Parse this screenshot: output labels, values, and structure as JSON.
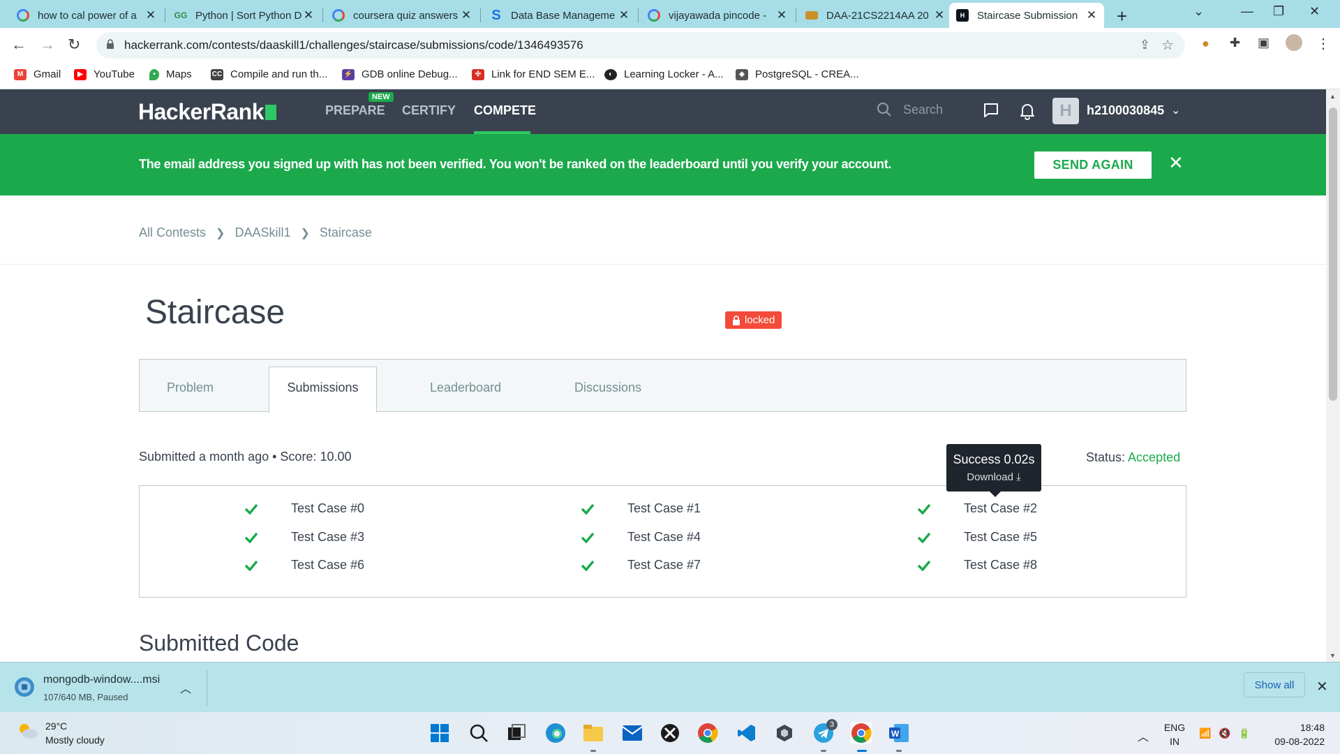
{
  "browser": {
    "tabs": [
      {
        "title": "how to cal power of a",
        "favicon": "google-icon",
        "color": "#4285f4"
      },
      {
        "title": "Python | Sort Python D",
        "favicon": "geeksforgeeks-icon",
        "color": "#2f8d46"
      },
      {
        "title": "coursera quiz answers",
        "favicon": "google-icon",
        "color": "#4285f4"
      },
      {
        "title": "Data Base Manageme",
        "favicon": "s-logo-icon",
        "color": "#1a73e8"
      },
      {
        "title": "vijayawada pincode -",
        "favicon": "google-icon",
        "color": "#4285f4"
      },
      {
        "title": "DAA-21CS2214AA 20",
        "favicon": "graduation-cap-icon",
        "color": "#c8912a"
      },
      {
        "title": "Staircase Submission",
        "favicon": "hackerrank-icon",
        "color": "#0e141e",
        "active": true
      }
    ],
    "url": "hackerrank.com/contests/daaskill1/challenges/staircase/submissions/code/1346493576",
    "bookmarks": [
      {
        "label": "Gmail",
        "icon": "gmail-icon",
        "color": "#ea4335"
      },
      {
        "label": "YouTube",
        "icon": "youtube-icon",
        "color": "#ff0000"
      },
      {
        "label": "Maps",
        "icon": "maps-icon",
        "color": "#34a853"
      },
      {
        "label": "Compile and run th...",
        "icon": "cc-icon",
        "color": "#444444"
      },
      {
        "label": "GDB online Debug...",
        "icon": "gdb-icon",
        "color": "#5b3fa8"
      },
      {
        "label": "Link for END SEM E...",
        "icon": "link-icon",
        "color": "#d93025"
      },
      {
        "label": "Learning Locker - A...",
        "icon": "learning-locker-icon",
        "color": "#222222"
      },
      {
        "label": "PostgreSQL - CREA...",
        "icon": "postgresql-icon",
        "color": "#555555"
      }
    ]
  },
  "hackerrank": {
    "logo": "HackerRank",
    "nav": {
      "prepare": "PREPARE",
      "new_badge": "NEW",
      "certify": "CERTIFY",
      "compete": "COMPETE"
    },
    "search_placeholder": "Search",
    "username": "h2100030845",
    "avatar_letter": "H",
    "banner": {
      "message": "The email address you signed up with has not been verified. You won't be ranked on the leaderboard until you verify your account.",
      "button": "SEND AGAIN",
      "close": "✕"
    },
    "breadcrumb": [
      "All Contests",
      "DAASkill1",
      "Staircase"
    ],
    "challenge_title": "Staircase",
    "locked_label": "locked",
    "tabs": [
      "Problem",
      "Submissions",
      "Leaderboard",
      "Discussions"
    ],
    "active_tab": "Submissions",
    "submission": {
      "info": "Submitted a month ago • Score: 10.00",
      "status_label": "Status:",
      "status_value": "Accepted",
      "tooltip_title": "Success 0.02s",
      "tooltip_action": "Download"
    },
    "test_cases": [
      "Test Case #0",
      "Test Case #1",
      "Test Case #2",
      "Test Case #3",
      "Test Case #4",
      "Test Case #5",
      "Test Case #6",
      "Test Case #7",
      "Test Case #8"
    ],
    "submitted_code_heading": "Submitted Code",
    "colors": {
      "green": "#1ba94c",
      "nav": "#39424e",
      "locked": "#f34a3a"
    }
  },
  "download_shelf": {
    "file": "mongodb-window....msi",
    "status": "107/640 MB, Paused",
    "show_all": "Show all"
  },
  "taskbar": {
    "temperature": "29°C",
    "weather": "Mostly cloudy",
    "lang1": "ENG",
    "lang2": "IN",
    "time": "18:48",
    "date": "09-08-2022",
    "telegram_badge": "3"
  }
}
